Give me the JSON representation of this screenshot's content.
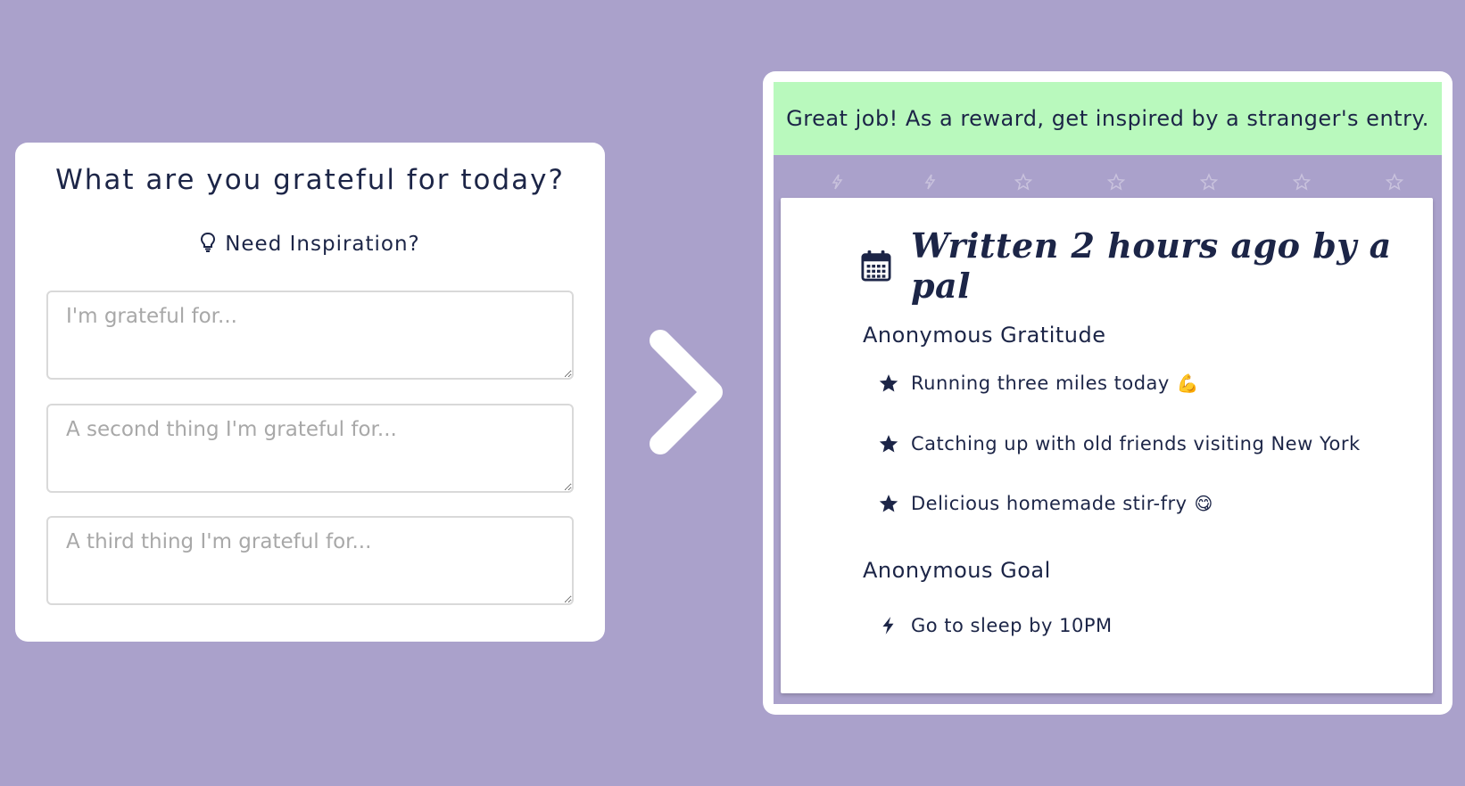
{
  "form": {
    "title": "What are you grateful for today?",
    "inspiration_label": "Need Inspiration?",
    "fields": [
      {
        "placeholder": "I'm grateful for..."
      },
      {
        "placeholder": "A second thing I'm grateful for..."
      },
      {
        "placeholder": "A third thing I'm grateful for..."
      }
    ]
  },
  "result": {
    "banner": "Great job! As a reward, get inspired by a stranger's entry.",
    "entry": {
      "title": "Written 2 hours ago by a pal",
      "gratitude_heading": "Anonymous Gratitude",
      "gratitude_items": [
        {
          "text": "Running three miles today",
          "emoji": "💪"
        },
        {
          "text": "Catching up with old friends visiting New York",
          "emoji": ""
        },
        {
          "text": "Delicious homemade stir-fry",
          "emoji": "😋"
        }
      ],
      "goal_heading": "Anonymous Goal",
      "goal_items": [
        {
          "text": "Go to sleep by 10PM"
        }
      ]
    }
  },
  "icons": {
    "bulb": "lightbulb-icon",
    "arrow": "chevron-right-icon",
    "calendar": "calendar-icon",
    "star": "star-icon",
    "bolt": "lightning-icon"
  },
  "colors": {
    "background": "#aaa1cb",
    "banner": "#b9f9bd",
    "text": "#1c2547"
  }
}
